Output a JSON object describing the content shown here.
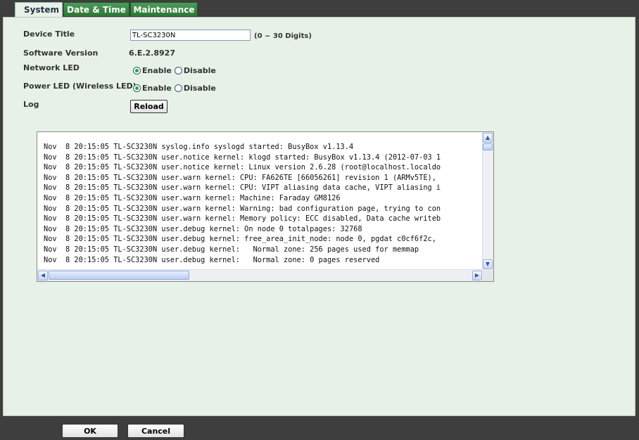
{
  "tabs": [
    {
      "label": "System"
    },
    {
      "label": "Date & Time"
    },
    {
      "label": "Maintenance"
    }
  ],
  "form": {
    "device_title_label": "Device Title",
    "device_title_value": "TL-SC3230N",
    "device_title_hint": "(0 ~ 30 Digits)",
    "software_version_label": "Software Version",
    "software_version_value": "6.E.2.8927",
    "network_led_label": "Network LED",
    "power_led_label": "Power LED (Wireless LED)",
    "enable_label": "Enable",
    "disable_label": "Disable",
    "network_led_selected": "Enable",
    "power_led_selected": "Enable",
    "log_label": "Log",
    "reload_label": "Reload"
  },
  "log": {
    "text": "Nov  8 20:15:05 TL-SC3230N syslog.info syslogd started: BusyBox v1.13.4\nNov  8 20:15:05 TL-SC3230N user.notice kernel: klogd started: BusyBox v1.13.4 (2012-07-03 1\nNov  8 20:15:05 TL-SC3230N user.notice kernel: Linux version 2.6.28 (root@localhost.localdo\nNov  8 20:15:05 TL-SC3230N user.warn kernel: CPU: FA626TE [66056261] revision 1 (ARMv5TE),\nNov  8 20:15:05 TL-SC3230N user.warn kernel: CPU: VIPT aliasing data cache, VIPT aliasing i\nNov  8 20:15:05 TL-SC3230N user.warn kernel: Machine: Faraday GM8126\nNov  8 20:15:05 TL-SC3230N user.warn kernel: Warning: bad configuration page, trying to con\nNov  8 20:15:05 TL-SC3230N user.warn kernel: Memory policy: ECC disabled, Data cache writeb\nNov  8 20:15:05 TL-SC3230N user.debug kernel: On node 0 totalpages: 32768\nNov  8 20:15:05 TL-SC3230N user.debug kernel: free_area_init_node: node 0, pgdat c0cf6f2c,\nNov  8 20:15:05 TL-SC3230N user.debug kernel:   Normal zone: 256 pages used for memmap\nNov  8 20:15:05 TL-SC3230N user.debug kernel:   Normal zone: 0 pages reserved"
  },
  "footer": {
    "ok_label": "OK",
    "cancel_label": "Cancel"
  }
}
